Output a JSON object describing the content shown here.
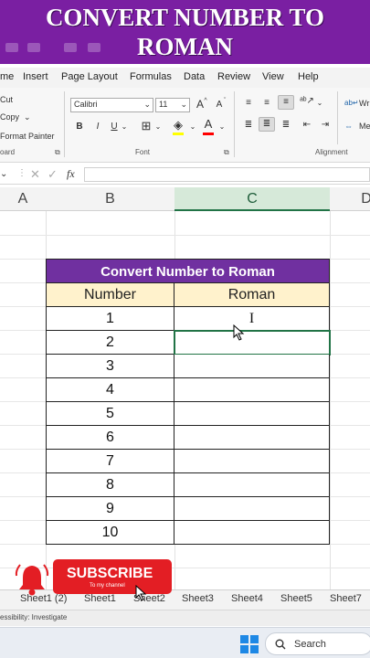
{
  "banner": {
    "line1": "CONVERT NUMBER TO",
    "line2": "ROMAN"
  },
  "menu": [
    "me",
    "Insert",
    "Page Layout",
    "Formulas",
    "Data",
    "Review",
    "View",
    "Help"
  ],
  "ribbon": {
    "clipboard": {
      "cut": "Cut",
      "copy": "Copy",
      "format_painter": "Format Painter",
      "label": "oard"
    },
    "font": {
      "name": "Calibri",
      "size": "11",
      "label": "Font",
      "grow": "A",
      "shrink": "A",
      "bold": "B",
      "italic": "I",
      "underline": "U"
    },
    "alignment": {
      "label": "Alignment",
      "wrap": "Wr",
      "merge": "Me"
    }
  },
  "formula_bar": {
    "fx": "fx",
    "value": ""
  },
  "columns": [
    "A",
    "B",
    "C",
    "D"
  ],
  "table": {
    "title": "Convert Number to Roman",
    "headers": [
      "Number",
      "Roman"
    ],
    "rows": [
      {
        "number": "1",
        "roman": "I"
      },
      {
        "number": "2",
        "roman": ""
      },
      {
        "number": "3",
        "roman": ""
      },
      {
        "number": "4",
        "roman": ""
      },
      {
        "number": "5",
        "roman": ""
      },
      {
        "number": "6",
        "roman": ""
      },
      {
        "number": "7",
        "roman": ""
      },
      {
        "number": "8",
        "roman": ""
      },
      {
        "number": "9",
        "roman": ""
      },
      {
        "number": "10",
        "roman": ""
      }
    ]
  },
  "sheets": [
    "Sheet1 (2)",
    "Sheet1",
    "Sheet2",
    "Sheet3",
    "Sheet4",
    "Sheet5",
    "Sheet7"
  ],
  "status": {
    "text": "essibility: Investigate"
  },
  "taskbar": {
    "search": "Search"
  },
  "subscribe": {
    "label": "SUBSCRIBE",
    "sub": "To my channel"
  },
  "colors": {
    "banner": "#7a1fa2",
    "table_title": "#7030a0",
    "header_fill": "#fff2cc",
    "excel_green": "#217346",
    "subscribe_red": "#e31e24"
  }
}
